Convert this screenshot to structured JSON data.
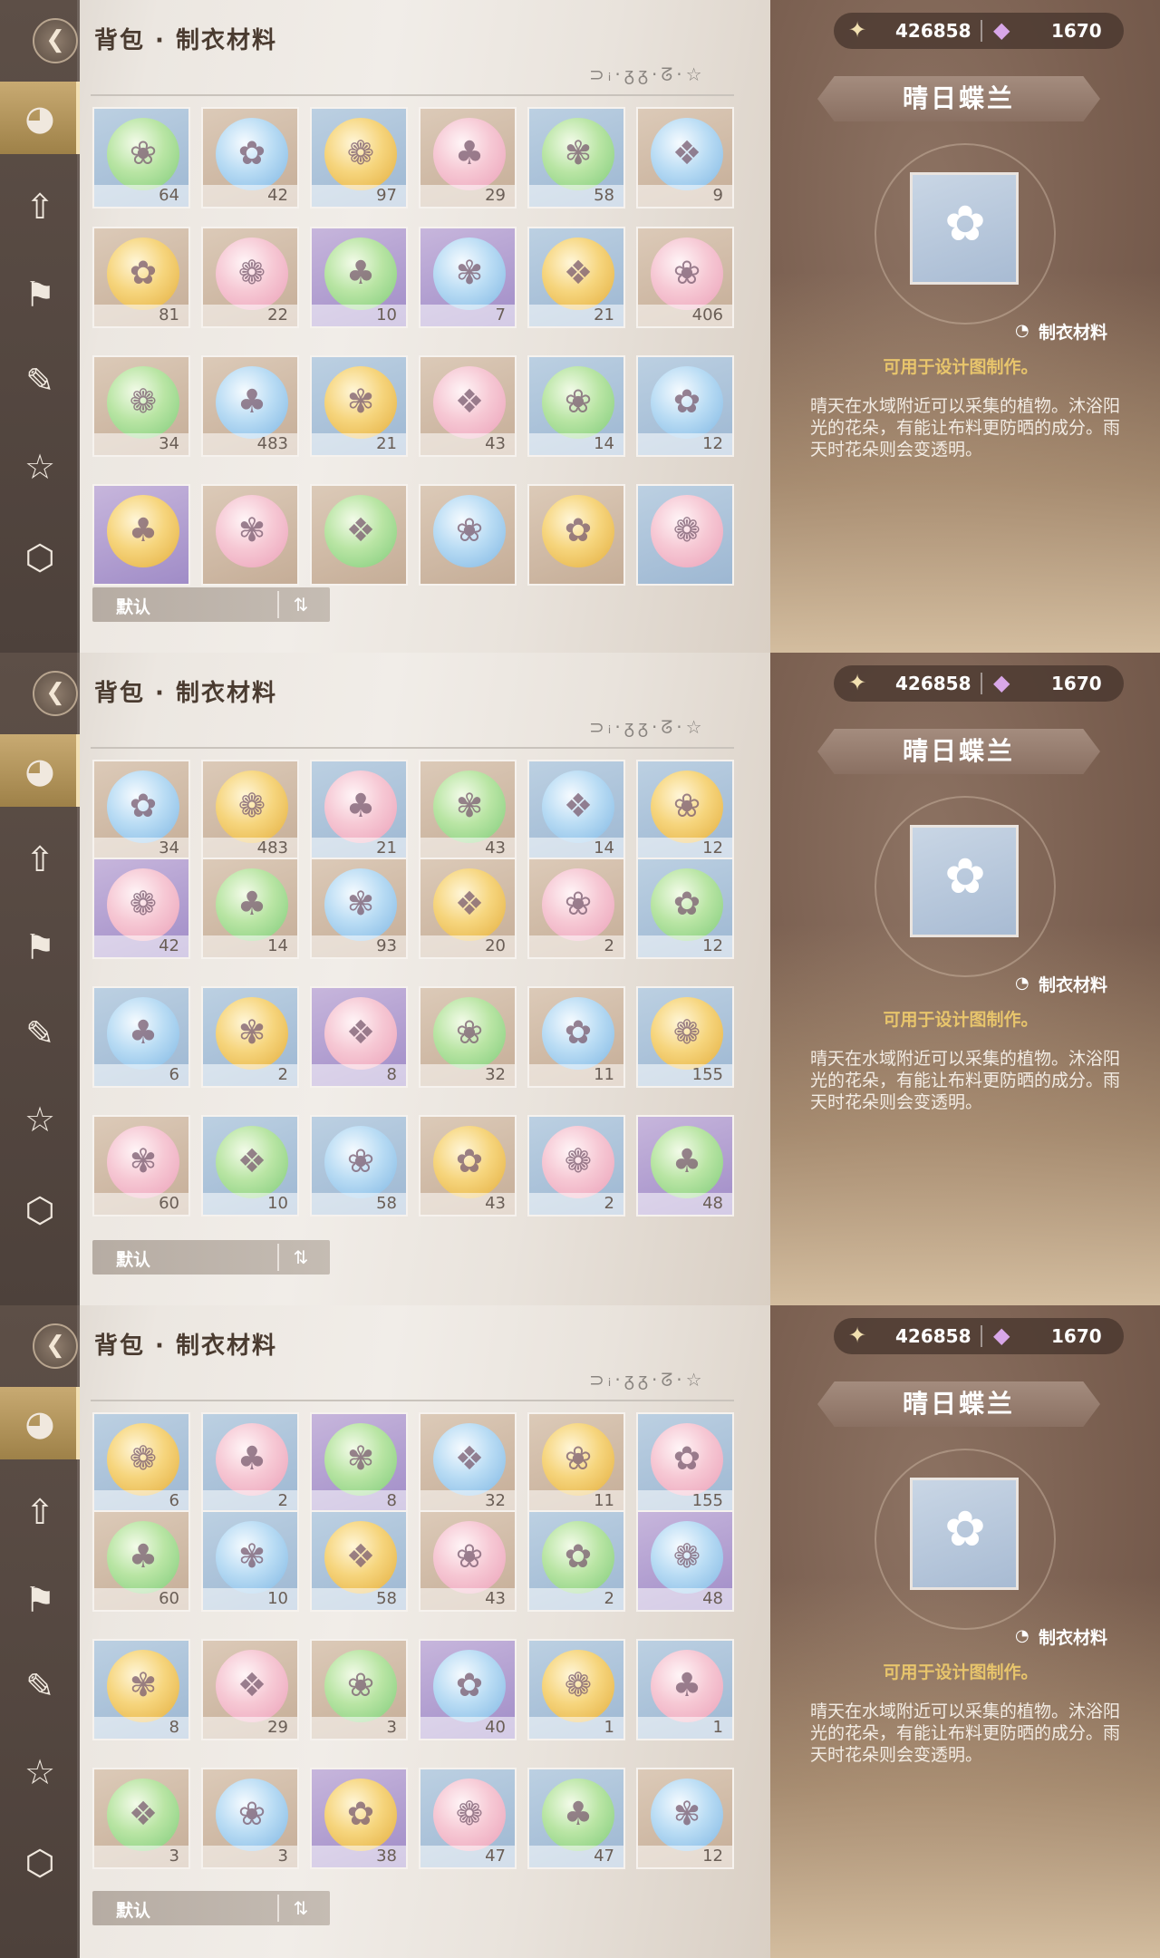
{
  "header": {
    "title": "背包 · 制衣材料",
    "sort_glyphs": "⊃ᵢ·ᵹᵹ·ᘔ·☆"
  },
  "currency": {
    "gold": "426858",
    "gem": "1670",
    "gold_icon": "star-coin-icon",
    "gem_icon": "gem-icon"
  },
  "sidebar": {
    "items": [
      {
        "name": "wardrobe",
        "icon": "fish-ball-icon",
        "active": true
      },
      {
        "name": "upgrade",
        "icon": "arrow-up-icon"
      },
      {
        "name": "quest",
        "icon": "banner-icon"
      },
      {
        "name": "feather",
        "icon": "quill-icon"
      },
      {
        "name": "star",
        "icon": "star-icon"
      },
      {
        "name": "box",
        "icon": "box-icon"
      }
    ]
  },
  "sort": {
    "label": "默认"
  },
  "detail": {
    "name": "晴日蝶兰",
    "type": "制衣材料",
    "usage": "可用于设计图制作。",
    "description": "晴天在水域附近可以采集的植物。沐浴阳光的花朵，有能让布料更防晒的成分。雨天时花朵则会变透明。"
  },
  "screens": [
    {
      "rows": [
        [
          {
            "q": "64",
            "c": "blue"
          },
          {
            "q": "42",
            "c": "tan"
          },
          {
            "q": "97",
            "c": "blue"
          },
          {
            "q": "29",
            "c": "tan"
          },
          {
            "q": "58",
            "c": "blue"
          },
          {
            "q": "9",
            "c": "tan"
          }
        ],
        [
          {
            "q": "81",
            "c": "tan"
          },
          {
            "q": "22",
            "c": "tan"
          },
          {
            "q": "10",
            "c": "purple"
          },
          {
            "q": "7",
            "c": "purple"
          },
          {
            "q": "21",
            "c": "blue"
          },
          {
            "q": "406",
            "c": "tan"
          }
        ],
        [
          {
            "q": "34",
            "c": "tan"
          },
          {
            "q": "483",
            "c": "tan"
          },
          {
            "q": "21",
            "c": "blue"
          },
          {
            "q": "43",
            "c": "tan"
          },
          {
            "q": "14",
            "c": "blue"
          },
          {
            "q": "12",
            "c": "blue"
          }
        ],
        [
          {
            "q": "",
            "c": "purple"
          },
          {
            "q": "",
            "c": "tan"
          },
          {
            "q": "",
            "c": "tan"
          },
          {
            "q": "",
            "c": "tan"
          },
          {
            "q": "",
            "c": "tan"
          },
          {
            "q": "",
            "c": "blue"
          }
        ]
      ]
    },
    {
      "rows": [
        [
          {
            "q": "34",
            "c": "tan"
          },
          {
            "q": "483",
            "c": "tan"
          },
          {
            "q": "21",
            "c": "blue"
          },
          {
            "q": "43",
            "c": "tan"
          },
          {
            "q": "14",
            "c": "blue"
          },
          {
            "q": "12",
            "c": "blue"
          }
        ],
        [
          {
            "q": "42",
            "c": "purple"
          },
          {
            "q": "14",
            "c": "tan"
          },
          {
            "q": "93",
            "c": "tan"
          },
          {
            "q": "20",
            "c": "tan"
          },
          {
            "q": "2",
            "c": "tan"
          },
          {
            "q": "12",
            "c": "blue"
          }
        ],
        [
          {
            "q": "6",
            "c": "blue"
          },
          {
            "q": "2",
            "c": "blue"
          },
          {
            "q": "8",
            "c": "purple"
          },
          {
            "q": "32",
            "c": "tan"
          },
          {
            "q": "11",
            "c": "tan"
          },
          {
            "q": "155",
            "c": "blue"
          }
        ],
        [
          {
            "q": "60",
            "c": "tan"
          },
          {
            "q": "10",
            "c": "blue"
          },
          {
            "q": "58",
            "c": "blue"
          },
          {
            "q": "43",
            "c": "tan"
          },
          {
            "q": "2",
            "c": "blue"
          },
          {
            "q": "48",
            "c": "purple"
          }
        ]
      ]
    },
    {
      "rows": [
        [
          {
            "q": "6",
            "c": "blue"
          },
          {
            "q": "2",
            "c": "blue"
          },
          {
            "q": "8",
            "c": "purple"
          },
          {
            "q": "32",
            "c": "tan"
          },
          {
            "q": "11",
            "c": "tan"
          },
          {
            "q": "155",
            "c": "blue"
          }
        ],
        [
          {
            "q": "60",
            "c": "tan"
          },
          {
            "q": "10",
            "c": "blue"
          },
          {
            "q": "58",
            "c": "blue"
          },
          {
            "q": "43",
            "c": "tan"
          },
          {
            "q": "2",
            "c": "blue"
          },
          {
            "q": "48",
            "c": "purple"
          }
        ],
        [
          {
            "q": "8",
            "c": "blue"
          },
          {
            "q": "29",
            "c": "tan"
          },
          {
            "q": "3",
            "c": "tan"
          },
          {
            "q": "40",
            "c": "purple"
          },
          {
            "q": "1",
            "c": "blue"
          },
          {
            "q": "1",
            "c": "blue"
          }
        ],
        [
          {
            "q": "3",
            "c": "tan"
          },
          {
            "q": "3",
            "c": "tan"
          },
          {
            "q": "38",
            "c": "purple"
          },
          {
            "q": "47",
            "c": "blue"
          },
          {
            "q": "47",
            "c": "blue"
          },
          {
            "q": "12",
            "c": "tan"
          }
        ]
      ]
    }
  ]
}
